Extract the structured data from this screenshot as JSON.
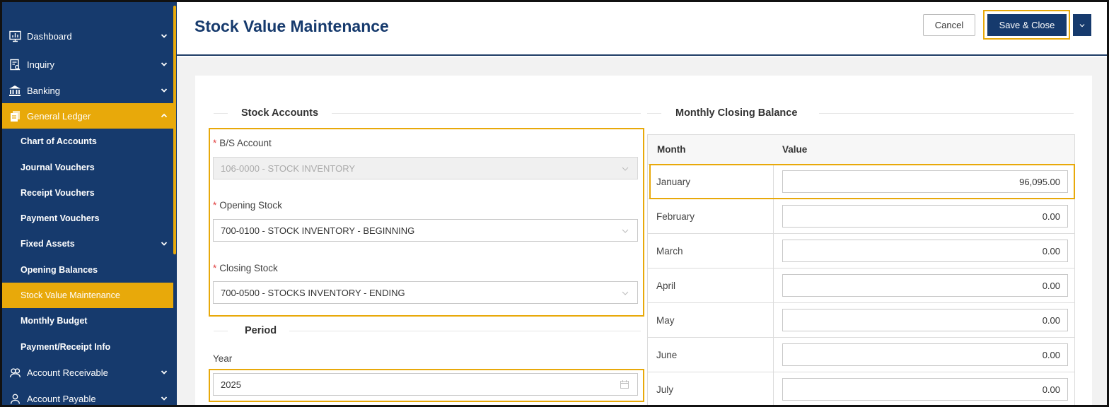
{
  "sidebar": {
    "items": [
      {
        "label": "Dashboard",
        "icon": "dashboard-icon"
      },
      {
        "label": "Inquiry",
        "icon": "inquiry-icon"
      },
      {
        "label": "Banking",
        "icon": "bank-icon"
      },
      {
        "label": "General Ledger",
        "icon": "ledger-icon"
      }
    ],
    "sub_items": [
      {
        "label": "Chart of Accounts"
      },
      {
        "label": "Journal Vouchers"
      },
      {
        "label": "Receipt Vouchers"
      },
      {
        "label": "Payment Vouchers"
      },
      {
        "label": "Fixed Assets"
      },
      {
        "label": "Opening Balances"
      },
      {
        "label": "Stock Value Maintenance"
      },
      {
        "label": "Monthly Budget"
      },
      {
        "label": "Payment/Receipt Info"
      }
    ],
    "bottom_items": [
      {
        "label": "Account Receivable",
        "icon": "receivable-icon"
      },
      {
        "label": "Account Payable",
        "icon": "payable-icon"
      }
    ],
    "accent_color": "#e8a90a",
    "bg_color": "#163a6d"
  },
  "header": {
    "title": "Stock Value Maintenance",
    "cancel_label": "Cancel",
    "save_label": "Save & Close"
  },
  "stock_accounts": {
    "legend": "Stock Accounts",
    "bs_account_label": "B/S Account",
    "bs_account_value": "106-0000 - STOCK INVENTORY",
    "opening_stock_label": "Opening Stock",
    "opening_stock_value": "700-0100 - STOCK INVENTORY - BEGINNING",
    "closing_stock_label": "Closing Stock",
    "closing_stock_value": "700-0500 - STOCKS INVENTORY - ENDING"
  },
  "period": {
    "legend": "Period",
    "year_label": "Year",
    "year_value": "2025"
  },
  "monthly": {
    "legend": "Monthly Closing Balance",
    "col_month": "Month",
    "col_value": "Value",
    "rows": [
      {
        "month": "January",
        "value": "96,095.00"
      },
      {
        "month": "February",
        "value": "0.00"
      },
      {
        "month": "March",
        "value": "0.00"
      },
      {
        "month": "April",
        "value": "0.00"
      },
      {
        "month": "May",
        "value": "0.00"
      },
      {
        "month": "June",
        "value": "0.00"
      },
      {
        "month": "July",
        "value": "0.00"
      }
    ]
  }
}
